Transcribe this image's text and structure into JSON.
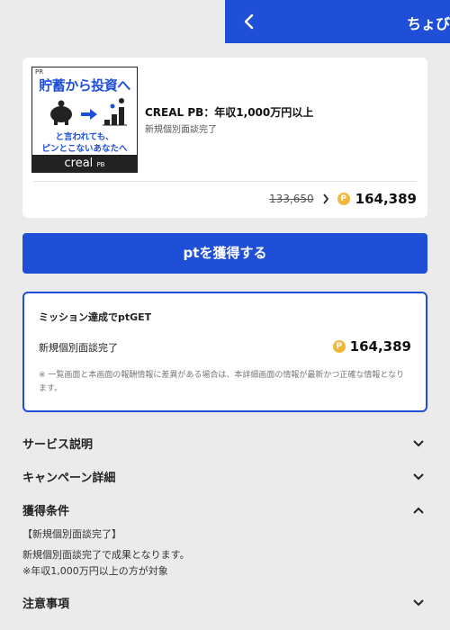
{
  "header": {
    "title": "ちょびリッチ",
    "back_icon": "chevron-left-icon",
    "color": "#1f4fd6"
  },
  "offer": {
    "banner": {
      "pr": "PR",
      "headline": "貯蓄から投資へ",
      "sub_line1": "と言われても、",
      "sub_line2": "ピンとこないあなたへ",
      "logo": "creal",
      "logo_suffix": "PB",
      "illustration": "piggy-bank-to-investment-icon"
    },
    "title": "CREAL PB：年収1,000万円以上",
    "subtitle": "新規個別面談完了",
    "old_points": "133,650",
    "points": "164,389",
    "coin_icon": "point-coin-icon",
    "coin_letter": "P"
  },
  "cta": {
    "label": "ptを獲得する"
  },
  "mission": {
    "title": "ミッション達成でptGET",
    "condition": "新規個別面談完了",
    "points": "164,389",
    "note": "※ 一覧画面と本画面の報酬情報に差異がある場合は、本詳細画面の情報が最新かつ正確な情報となります。"
  },
  "sections": [
    {
      "label": "サービス説明",
      "expanded": false
    },
    {
      "label": "キャンペーン詳細",
      "expanded": false
    },
    {
      "label": "獲得条件",
      "expanded": true
    },
    {
      "label": "注意事項",
      "expanded": false
    }
  ],
  "conditions": {
    "heading": "【新規個別面談完了】",
    "line1": "新規個別面談完了で成果となります。",
    "line2": "※年収1,000万円以上の方が対象"
  }
}
